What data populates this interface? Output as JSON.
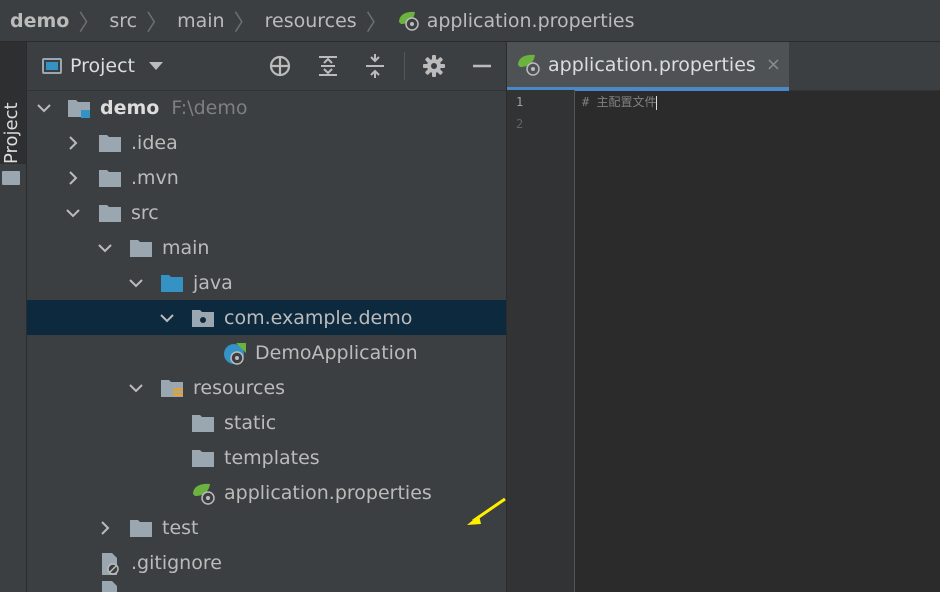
{
  "breadcrumb": {
    "items": [
      "demo",
      "src",
      "main",
      "resources"
    ],
    "file": "application.properties"
  },
  "left_stripe": {
    "label": "Project"
  },
  "project_panel": {
    "title": "Project",
    "tree": [
      {
        "label": "demo",
        "path": "F:\\demo",
        "expanded": true
      },
      {
        "label": ".idea",
        "expanded": false
      },
      {
        "label": ".mvn",
        "expanded": false
      },
      {
        "label": "src",
        "expanded": true
      },
      {
        "label": "main",
        "expanded": true
      },
      {
        "label": "java",
        "expanded": true
      },
      {
        "label": "com.example.demo",
        "expanded": true,
        "selected": true
      },
      {
        "label": "DemoApplication"
      },
      {
        "label": "resources",
        "expanded": true
      },
      {
        "label": "static"
      },
      {
        "label": "templates"
      },
      {
        "label": "application.properties"
      },
      {
        "label": "test",
        "expanded": false
      },
      {
        "label": ".gitignore"
      }
    ]
  },
  "editor": {
    "tab_label": "application.properties",
    "close_glyph": "×",
    "line_numbers": [
      "1",
      "2"
    ],
    "lines": [
      "# 主配置文件"
    ]
  },
  "colors": {
    "accent": "#4a88c7",
    "selection": "#0d293e",
    "folder": "#9aa7b0",
    "source_folder": "#3592c4",
    "spring_green": "#6bb23f",
    "annotation_arrow": "#ffee00"
  }
}
